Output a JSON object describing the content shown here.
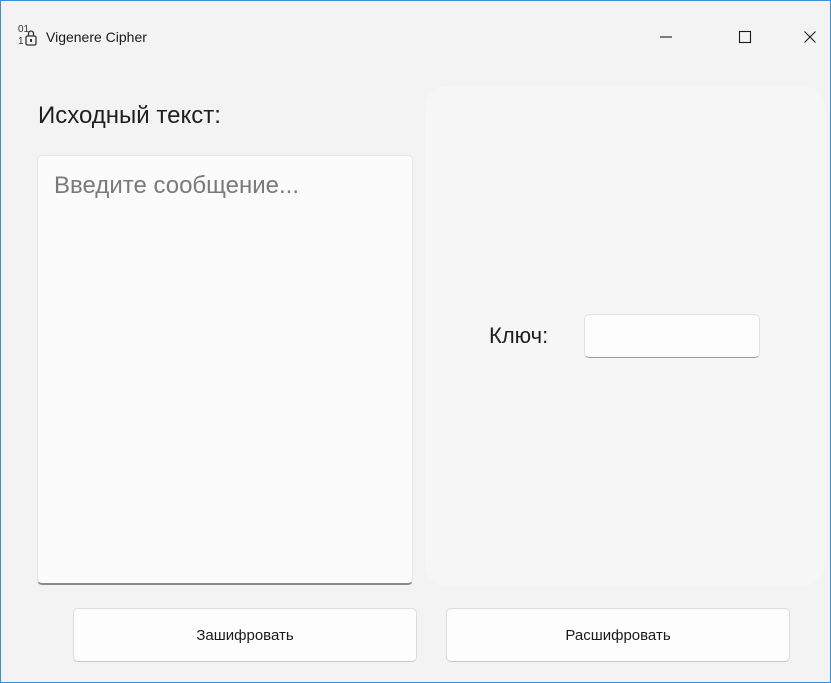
{
  "window": {
    "title": "Vigenere Cipher",
    "icon": "binary-lock-icon",
    "controls": {
      "minimize": "minimize-icon",
      "maximize": "maximize-icon",
      "close": "close-icon"
    }
  },
  "source": {
    "label": "Исходный текст:",
    "placeholder": "Введите сообщение...",
    "value": ""
  },
  "key": {
    "label": "Ключ:",
    "value": ""
  },
  "actions": {
    "encrypt_label": "Зашифровать",
    "decrypt_label": "Расшифровать"
  },
  "colors": {
    "window_border": "#3a8fd6",
    "background": "#f3f3f3",
    "panel": "#f6f6f6"
  }
}
